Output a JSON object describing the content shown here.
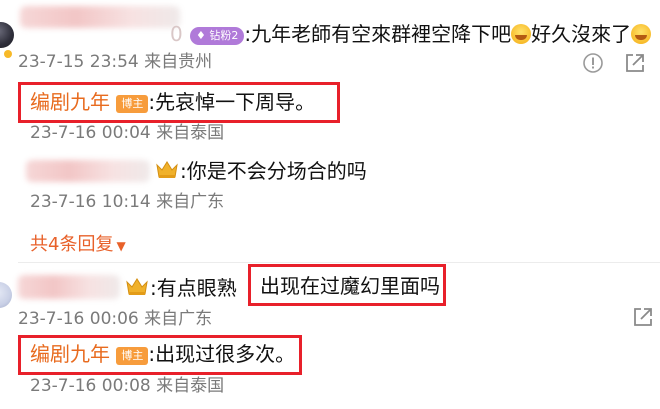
{
  "comment1": {
    "text_before_emoji1": ":九年老師有空來群裡空降下吧",
    "text_between_emojis": "好久沒來了",
    "fan_badge": "钻粉2",
    "fan_badge_partial_digit": "0",
    "meta": "23-7-15 23:54 来自贵州",
    "icons": [
      "alert-icon",
      "share-icon"
    ]
  },
  "reply1": {
    "author": "编剧九年",
    "badge": "博主",
    "text": ":先哀悼一下周导。",
    "meta": "23-7-16 00:04 来自泰国"
  },
  "reply2": {
    "text": ":你是不会分场合的吗",
    "meta": "23-7-16 10:14 来自广东"
  },
  "more_replies": "共4条回复",
  "comment2": {
    "text_plain": ":有点眼熟",
    "text_highlight": "出现在过魔幻里面吗",
    "meta": "23-7-16 00:06 来自广东",
    "icons": [
      "share-icon"
    ]
  },
  "reply3": {
    "author": "编剧九年",
    "badge": "博主",
    "text": ":出现过很多次。",
    "meta": "23-7-16 00:08 来自泰国"
  },
  "colors": {
    "highlight_border": "#e8202a",
    "author": "#e86b1f",
    "badge": "#f79c3c",
    "fan_badge": "#b07ad9",
    "meta_text": "#7a7a7a",
    "more_link": "#e8612a"
  }
}
